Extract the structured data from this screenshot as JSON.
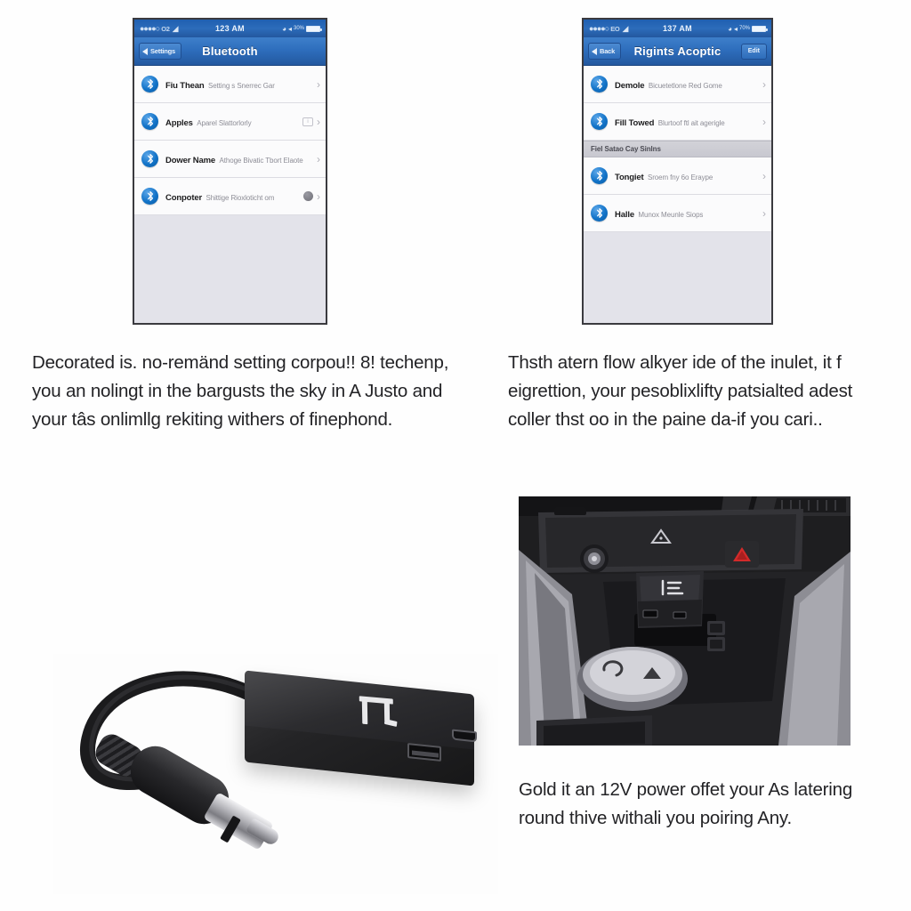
{
  "panels": {
    "phone_left": {
      "status_bar": {
        "signal_dots": "●●●●○",
        "carrier": "O2",
        "wifi_icon": "wifi-icon",
        "time": "123 AM",
        "alarm_icon": "alarm-icon",
        "location_icon": "location-icon",
        "battery_pct": "30%",
        "battery_icon": "battery-icon"
      },
      "navbar": {
        "back_label": "Settings",
        "title": "Bluetooth",
        "has_edit": false,
        "edit_label": ""
      },
      "rows": [
        {
          "title": "Fiu Thean",
          "subtitle": "Setting s Snerrec Gar",
          "accessory": "chevron",
          "badge": false
        },
        {
          "title": "Apples",
          "subtitle": "Aparel Slattorlorly",
          "accessory": "chevron",
          "badge": true
        },
        {
          "title": "Dower Name",
          "subtitle": "Athoge Bivatic Tbort Elaote",
          "accessory": "chevron",
          "badge": false
        },
        {
          "title": "Conpoter",
          "subtitle": "Shittige Rioxloticht om",
          "accessory": "spinner",
          "badge": false
        }
      ],
      "section_header": ""
    },
    "phone_right": {
      "status_bar": {
        "signal_dots": "●●●●○",
        "carrier": "EO",
        "wifi_icon": "wifi-icon",
        "time": "137 AM",
        "alarm_icon": "alarm-icon",
        "location_icon": "location-icon",
        "battery_pct": "70%",
        "battery_icon": "battery-icon"
      },
      "navbar": {
        "back_label": "Back",
        "title": "Rigints Acoptic",
        "has_edit": true,
        "edit_label": "Edit"
      },
      "rows_top": [
        {
          "title": "Demole",
          "subtitle": "Bicuetetlone Red Gome",
          "accessory": "chevron",
          "badge": false
        },
        {
          "title": "Fill Towed",
          "subtitle": "Blurtoof ftl ait agerigle",
          "accessory": "chevron",
          "badge": false
        }
      ],
      "section_header": "Fiel Satao Cay Sinlns",
      "rows_bottom": [
        {
          "title": "Tongiet",
          "subtitle": "Sroem fny 6o Eraype",
          "accessory": "chevron",
          "badge": false
        },
        {
          "title": "Halle",
          "subtitle": "Munox Meunle Siops",
          "accessory": "chevron",
          "badge": false
        }
      ]
    }
  },
  "captions": {
    "top_left": "Decorated is. no-remänd setting corpou!! 8! techenp, you an nolingt in the bargusts the sky in A Justo and your tâs onlimllg rekiting withers of finephond.",
    "top_right": "Thsth atern flow alkyer ide of the inulet, it f eigrettion, your pesoblixlifty patsialted adest coller thst oo in the paine da-if you cari..",
    "bottom_right": "Gold it an 12V power offet your As latering round thive withali you poiring Any."
  },
  "photos": {
    "adapter": {
      "name": "bluetooth-audio-adapter",
      "description": "Black Bluetooth audio adapter with 3.5mm male jack cable, USB-A port and micro-USB port",
      "logo_icon": "brand-logo-icon",
      "ports": [
        "usb-a-port",
        "micro-usb-port"
      ],
      "connector": "3.5mm-aux-plug"
    },
    "car": {
      "name": "car-center-console",
      "description": "Car center console with adapter plugged into 12V power socket",
      "hazard_icon": "hazard-warning-icon",
      "airbag_icon": "airbag-warning-icon",
      "shifter": "gear-shifter",
      "socket": "12v-power-socket"
    }
  },
  "colors": {
    "nav_blue": "#2e6ebd",
    "status_blue": "#23589f",
    "bt_badge_blue": "#1273c8",
    "list_bg": "#fbfbfc",
    "page_bg": "#e3e3ea",
    "section_gray": "#c8c8d0",
    "hazard_red": "#d32a2a",
    "text_dark": "#1c1c1e",
    "text_muted": "#8d8d96"
  }
}
